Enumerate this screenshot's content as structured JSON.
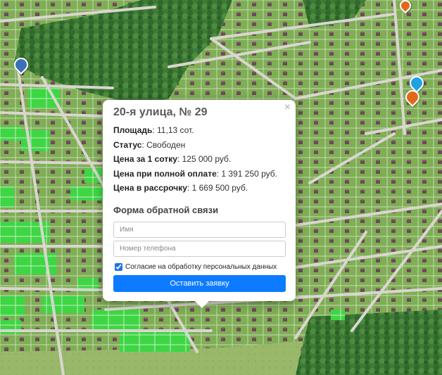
{
  "popup": {
    "close_symbol": "×",
    "title": "20-я улица, № 29",
    "area_label": "Площадь",
    "area_value": ": 11,13 сот.",
    "status_label": "Статус",
    "status_value": ": Свободен",
    "price_per_sotka_label": "Цена за 1 сотку",
    "price_per_sotka_value": ": 125 000 руб.",
    "full_price_label": "Цена при полной оплате",
    "full_price_value": ": 1 391 250 руб.",
    "installment_price_label": "Цена в рассрочку",
    "installment_price_value": ": 1 669 500 руб.",
    "form_title": "Форма обратной связи",
    "name_placeholder": "Имя",
    "phone_placeholder": "Номер телефона",
    "consent_label": "Согласие на обработку персональных данных",
    "consent_checked": true,
    "submit_label": "Оставить заявку"
  },
  "colors": {
    "available_plot": "#3fd645",
    "submit_button": "#0d7bff",
    "title_text": "#5a5a5a"
  },
  "markers": [
    {
      "name": "location-pin-icon",
      "color": "#3b6fb6"
    },
    {
      "name": "info-pin-icon",
      "color": "#1fa3e0"
    },
    {
      "name": "poi-pin-icon",
      "color": "#e06a1a"
    }
  ]
}
